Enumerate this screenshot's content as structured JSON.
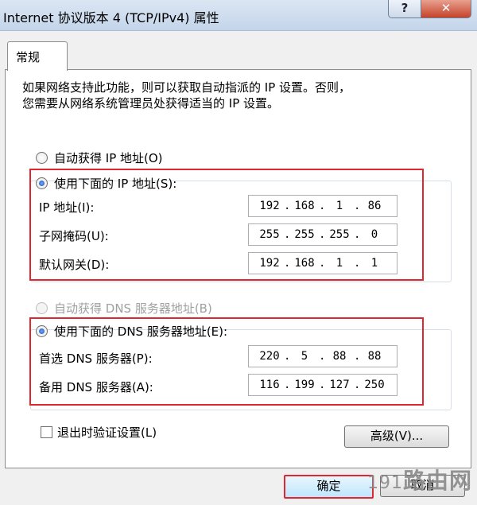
{
  "window": {
    "title": "Internet 协议版本 4 (TCP/IPv4) 属性",
    "help_label": "?",
    "close_label": "✕"
  },
  "tabs": [
    {
      "label": "常规"
    }
  ],
  "description": {
    "line1": "如果网络支持此功能，则可以获取自动指派的 IP 设置。否则，",
    "line2": "您需要从网络系统管理员处获得适当的 IP 设置。"
  },
  "ip_section": {
    "auto_label": "自动获得 IP 地址(O)",
    "manual_label": "使用下面的 IP 地址(S):",
    "selected": "manual",
    "fields": [
      {
        "label": "IP 地址(I):",
        "octets": [
          "192",
          "168",
          "1",
          "86"
        ]
      },
      {
        "label": "子网掩码(U):",
        "octets": [
          "255",
          "255",
          "255",
          "0"
        ]
      },
      {
        "label": "默认网关(D):",
        "octets": [
          "192",
          "168",
          "1",
          "1"
        ]
      }
    ]
  },
  "dns_section": {
    "auto_label": "自动获得 DNS 服务器地址(B)",
    "manual_label": "使用下面的 DNS 服务器地址(E):",
    "selected": "manual",
    "fields": [
      {
        "label": "首选 DNS 服务器(P):",
        "octets": [
          "220",
          "5",
          "88",
          "88"
        ]
      },
      {
        "label": "备用 DNS 服务器(A):",
        "octets": [
          "116",
          "199",
          "127",
          "250"
        ]
      }
    ]
  },
  "validate_label": "退出时验证设置(L)",
  "validate_checked": false,
  "buttons": {
    "advanced": "高级(V)...",
    "ok": "确定",
    "cancel": "取消"
  },
  "watermark": {
    "num": "191",
    "text": "路由网"
  },
  "colors": {
    "highlight": "#e0262e",
    "titlebar": "#c4d5ea"
  }
}
